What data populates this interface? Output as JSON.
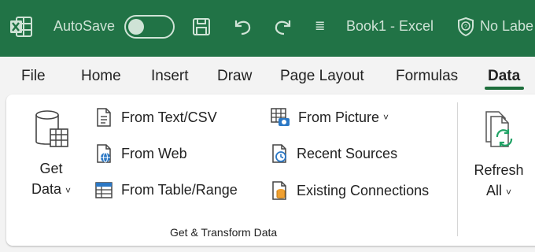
{
  "titlebar": {
    "autosave_label": "AutoSave",
    "qat_more": "≣",
    "book_title": "Book1  -  Excel",
    "sensitivity_label": "No Labe"
  },
  "tabs": [
    "File",
    "Home",
    "Insert",
    "Draw",
    "Page Layout",
    "Formulas",
    "Data"
  ],
  "active_tab": "Data",
  "get_data": {
    "line1": "Get",
    "line2": "Data",
    "chevron": "˅"
  },
  "commands": {
    "from_text_csv": "From Text/CSV",
    "from_web": "From Web",
    "from_table_range": "From Table/Range",
    "from_picture": "From Picture",
    "recent_sources": "Recent Sources",
    "existing_connections": "Existing Connections"
  },
  "group_label": "Get & Transform Data",
  "refresh": {
    "line1": "Refresh",
    "line2": "All",
    "chevron": "˅"
  },
  "colors": {
    "titlebar": "#217346",
    "accent": "#1e6e3c",
    "ribbon_bg": "#ffffff",
    "tab_bg": "#f3f3f3"
  }
}
